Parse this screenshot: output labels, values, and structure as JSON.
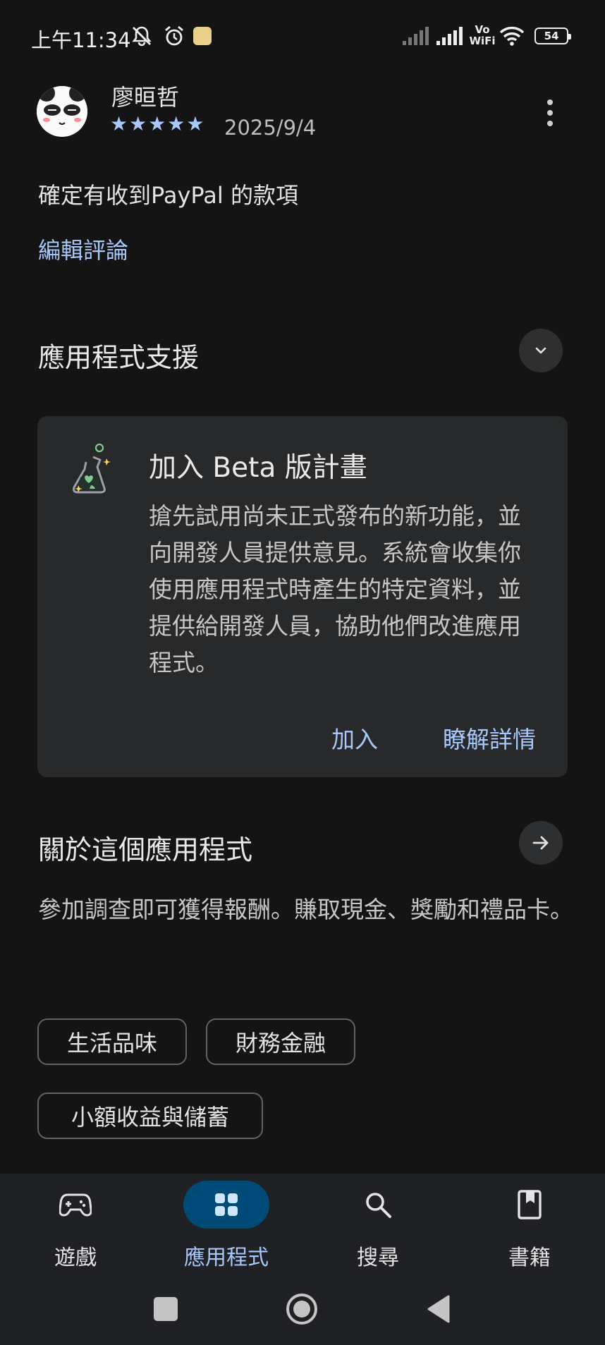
{
  "status_bar": {
    "time": "上午11:34",
    "battery": "54",
    "network_label": "Vo WiFi",
    "icons": [
      "mute-icon",
      "alarm-icon",
      "app-notification-icon",
      "signal-icon",
      "signal-icon",
      "wifi-icon",
      "battery-icon"
    ]
  },
  "review": {
    "reviewer_name": "廖晅哲",
    "rating": 5,
    "stars": "★★★★★",
    "date": "2025/9/4",
    "text": "確定有收到PayPal 的款項",
    "edit_label": "編輯評論"
  },
  "app_support": {
    "title": "應用程式支援"
  },
  "beta": {
    "title": "加入 Beta 版計畫",
    "description": "搶先試用尚未正式發布的新功能，並向開發人員提供意見。系統會收集你使用應用程式時產生的特定資料，並提供給開發人員，協助他們改進應用程式。",
    "join_label": "加入",
    "learn_more_label": "瞭解詳情"
  },
  "about": {
    "title": "關於這個應用程式",
    "description": "參加調查即可獲得報酬。賺取現金、獎勵和禮品卡。"
  },
  "tags": [
    "生活品味",
    "財務金融",
    "小額收益與儲蓄"
  ],
  "bottom_nav": {
    "items": [
      {
        "label": "遊戲",
        "icon": "gamepad-icon",
        "active": false
      },
      {
        "label": "應用程式",
        "icon": "apps-grid-icon",
        "active": true
      },
      {
        "label": "搜尋",
        "icon": "search-icon",
        "active": false
      },
      {
        "label": "書籍",
        "icon": "book-icon",
        "active": false
      }
    ]
  },
  "colors": {
    "background": "#141414",
    "accent": "#a8c7fa",
    "active_pill": "#004a77",
    "card": "#28292a"
  }
}
